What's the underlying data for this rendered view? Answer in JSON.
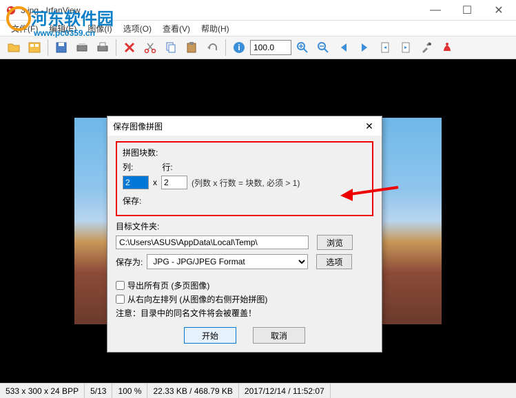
{
  "window": {
    "title": "3.jpg - IrfanView",
    "min": "—",
    "max": "☐",
    "close": "✕"
  },
  "watermark": {
    "text": "河东软件园",
    "sub": "www.pc0359.cn"
  },
  "menu": {
    "file": "文件(F)",
    "edit": "编辑(E)",
    "image": "图像(I)",
    "options": "选项(O)",
    "view": "查看(V)",
    "help": "帮助(H)"
  },
  "toolbar": {
    "zoom_value": "100.0"
  },
  "dialog": {
    "title": "保存图像拼图",
    "close": "✕",
    "group_blocks": "拼图块数:",
    "col_label": "列:",
    "row_label": "行:",
    "col_value": "2",
    "x": "x",
    "row_value": "2",
    "hint": "(列数 x 行数 = 块数, 必须 > 1)",
    "group_save": "保存:",
    "target_folder_label": "目标文件夹:",
    "target_folder_value": "C:\\Users\\ASUS\\AppData\\Local\\Temp\\",
    "browse": "浏览",
    "saveas_label": "保存为:",
    "format_value": "JPG - JPG/JPEG Format",
    "options_btn": "选项",
    "cb_export_all": "导出所有页 (多页图像)",
    "cb_rtl": "从右向左排列 (从图像的右侧开始拼图)",
    "warning": "注意：目录中的同名文件将会被覆盖！",
    "start": "开始",
    "cancel": "取消"
  },
  "status": {
    "dims": "533 x 300 x 24 BPP",
    "page": "5/13",
    "zoom": "100 %",
    "size": "22.33 KB / 468.79 KB",
    "date": "2017/12/14 / 11:52:07"
  }
}
